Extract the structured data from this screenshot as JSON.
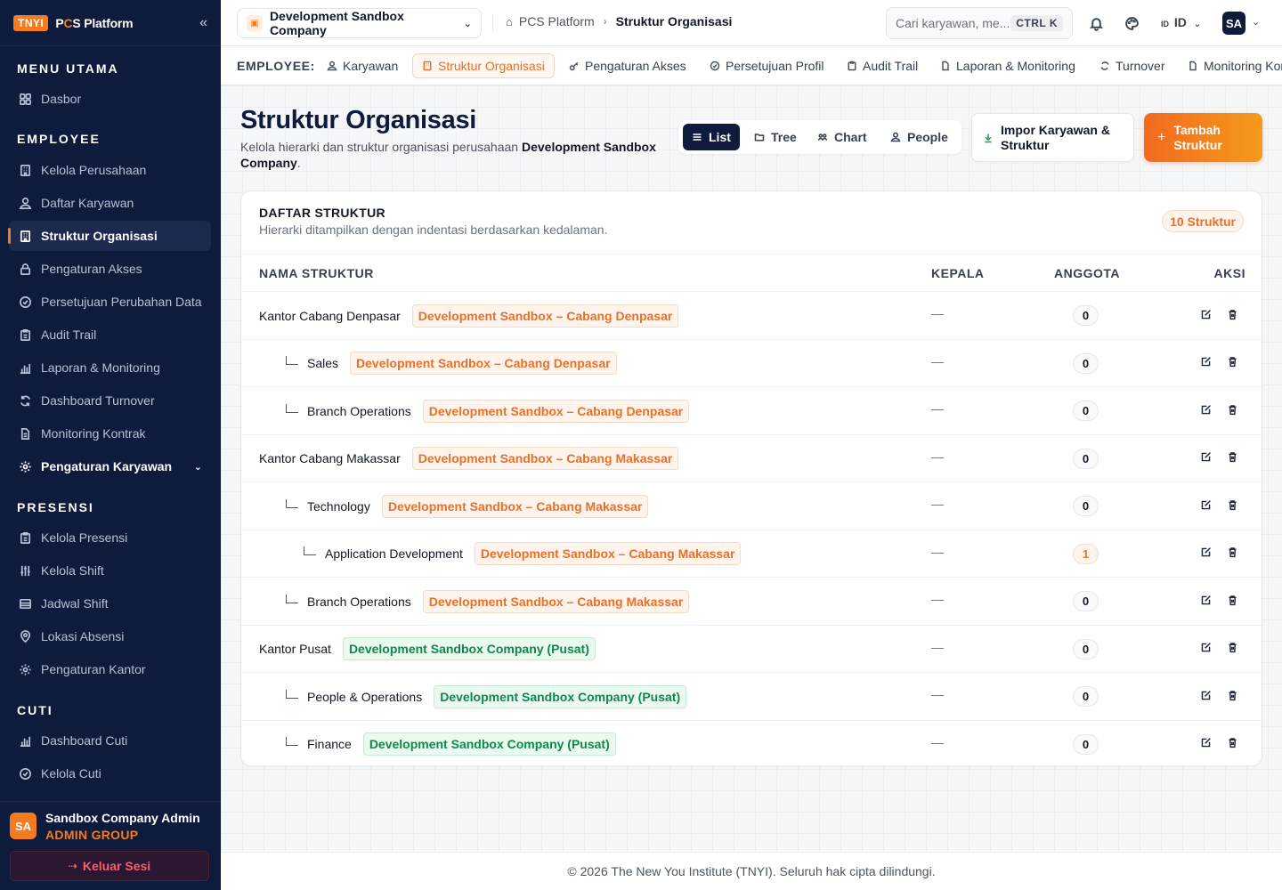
{
  "brand": {
    "badge": "TNYI",
    "name_prefix": "P",
    "name_accent": "C",
    "name_rest": "S Platform"
  },
  "sidebar": {
    "sections": [
      {
        "title": "MENU UTAMA"
      },
      {
        "title": "EMPLOYEE"
      },
      {
        "title": "PRESENSI"
      },
      {
        "title": "CUTI"
      }
    ],
    "items": [
      {
        "label": "Dasbor"
      },
      {
        "label": "Kelola Perusahaan"
      },
      {
        "label": "Daftar Karyawan"
      },
      {
        "label": "Struktur Organisasi"
      },
      {
        "label": "Pengaturan Akses"
      },
      {
        "label": "Persetujuan Perubahan Data"
      },
      {
        "label": "Audit Trail"
      },
      {
        "label": "Laporan & Monitoring"
      },
      {
        "label": "Dashboard Turnover"
      },
      {
        "label": "Monitoring Kontrak"
      },
      {
        "label": "Pengaturan Karyawan"
      },
      {
        "label": "Kelola Presensi"
      },
      {
        "label": "Kelola Shift"
      },
      {
        "label": "Jadwal Shift"
      },
      {
        "label": "Lokasi Absensi"
      },
      {
        "label": "Pengaturan Kantor"
      },
      {
        "label": "Dashboard Cuti"
      },
      {
        "label": "Kelola Cuti"
      }
    ],
    "profile": {
      "initials": "SA",
      "name": "Sandbox Company Admin",
      "role": "ADMIN GROUP",
      "logout": "Keluar Sesi"
    }
  },
  "topbar": {
    "company": "Development Sandbox Company",
    "breadcrumb": [
      "PCS Platform",
      "Struktur Organisasi"
    ],
    "search_placeholder": "Cari karyawan, me...",
    "search_kbd": "CTRL K",
    "lang_small": "ID",
    "lang": "ID",
    "user_initials": "SA"
  },
  "subnav": {
    "label": "EMPLOYEE:",
    "tabs": [
      {
        "label": "Karyawan"
      },
      {
        "label": "Struktur Organisasi"
      },
      {
        "label": "Pengaturan Akses"
      },
      {
        "label": "Persetujuan Profil"
      },
      {
        "label": "Audit Trail"
      },
      {
        "label": "Laporan & Monitoring"
      },
      {
        "label": "Turnover"
      },
      {
        "label": "Monitoring Kontrak"
      }
    ]
  },
  "page": {
    "title": "Struktur Organisasi",
    "desc_prefix": "Kelola hierarki dan struktur organisasi perusahaan ",
    "desc_company": "Development Sandbox Company",
    "desc_suffix": ".",
    "views": [
      "List",
      "Tree",
      "Chart",
      "People"
    ],
    "import_label": "Impor Karyawan & Struktur",
    "add_label": "Tambah Struktur"
  },
  "table": {
    "title": "DAFTAR STRUKTUR",
    "subtitle": "Hierarki ditampilkan dengan indentasi berdasarkan kedalaman.",
    "count": "10 Struktur",
    "columns": [
      "NAMA STRUKTUR",
      "KEPALA",
      "ANGGOTA",
      "AKSI"
    ],
    "rows": [
      {
        "name": "Kantor Cabang Denpasar",
        "level": 0,
        "tag": "Development Sandbox – Cabang Denpasar",
        "tag_color": "orange",
        "head": "—",
        "members": "0"
      },
      {
        "name": "Sales",
        "level": 1,
        "tag": "Development Sandbox – Cabang Denpasar",
        "tag_color": "orange",
        "head": "—",
        "members": "0"
      },
      {
        "name": "Branch Operations",
        "level": 1,
        "tag": "Development Sandbox – Cabang Denpasar",
        "tag_color": "orange",
        "head": "—",
        "members": "0"
      },
      {
        "name": "Kantor Cabang Makassar",
        "level": 0,
        "tag": "Development Sandbox – Cabang Makassar",
        "tag_color": "orange",
        "head": "—",
        "members": "0"
      },
      {
        "name": "Technology",
        "level": 1,
        "tag": "Development Sandbox – Cabang Makassar",
        "tag_color": "orange",
        "head": "—",
        "members": "0"
      },
      {
        "name": "Application Development",
        "level": 2,
        "tag": "Development Sandbox – Cabang Makassar",
        "tag_color": "orange",
        "head": "—",
        "members": "1"
      },
      {
        "name": "Branch Operations",
        "level": 1,
        "tag": "Development Sandbox – Cabang Makassar",
        "tag_color": "orange",
        "head": "—",
        "members": "0"
      },
      {
        "name": "Kantor Pusat",
        "level": 0,
        "tag": "Development Sandbox Company (Pusat)",
        "tag_color": "green",
        "head": "—",
        "members": "0"
      },
      {
        "name": "People & Operations",
        "level": 1,
        "tag": "Development Sandbox Company (Pusat)",
        "tag_color": "green",
        "head": "—",
        "members": "0"
      },
      {
        "name": "Finance",
        "level": 1,
        "tag": "Development Sandbox Company (Pusat)",
        "tag_color": "green",
        "head": "—",
        "members": "0"
      }
    ]
  },
  "footer": "© 2026 The New You Institute (TNYI). Seluruh hak cipta dilindungi.",
  "colors": {
    "accent": "#f47b20",
    "sidebar_bg": "#0f1b3d",
    "tag_green": "#10874d"
  }
}
